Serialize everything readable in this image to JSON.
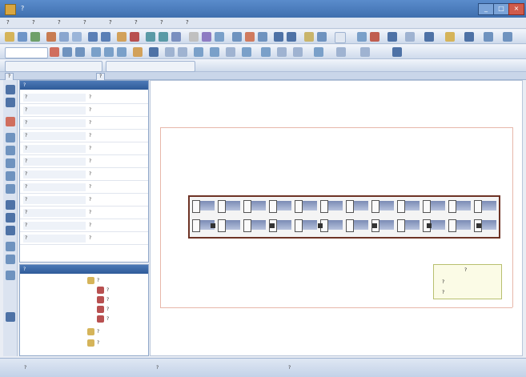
{
  "app": {
    "title": "?"
  },
  "window_buttons": {
    "minimize": "_",
    "maximize": "□",
    "close": "×"
  },
  "menu": [
    "?",
    "?",
    "?",
    "?",
    "?",
    "?",
    "?",
    "?"
  ],
  "tabs": [
    {
      "label": "?"
    },
    {
      "label": "?"
    }
  ],
  "properties": {
    "title": "?",
    "rows": [
      {
        "key": "?",
        "value": "?"
      },
      {
        "key": "?",
        "value": "?"
      },
      {
        "key": "?",
        "value": "?"
      },
      {
        "key": "?",
        "value": "?"
      },
      {
        "key": "?",
        "value": "?"
      },
      {
        "key": "?",
        "value": "?"
      },
      {
        "key": "?",
        "value": "?"
      },
      {
        "key": "?",
        "value": "?"
      },
      {
        "key": "?",
        "value": "?"
      },
      {
        "key": "?",
        "value": "?"
      },
      {
        "key": "?",
        "value": "?"
      },
      {
        "key": "?",
        "value": "?"
      }
    ]
  },
  "tree": {
    "title": "?",
    "items": [
      {
        "label": "?"
      },
      {
        "label": "?"
      },
      {
        "label": "?"
      },
      {
        "label": "?"
      },
      {
        "label": "?"
      },
      {
        "label": "?"
      },
      {
        "label": "?"
      }
    ]
  },
  "canvas": {
    "small_box": {
      "line1": "?",
      "line2": "?",
      "line3": "?"
    }
  },
  "status": {
    "left": "?",
    "middle": "?",
    "right": "?"
  },
  "colors": {
    "titlebar": "#3f6fae",
    "panel_head": "#2f5b99",
    "block_border": "#6e3325",
    "guide": "#e7b7aa"
  }
}
